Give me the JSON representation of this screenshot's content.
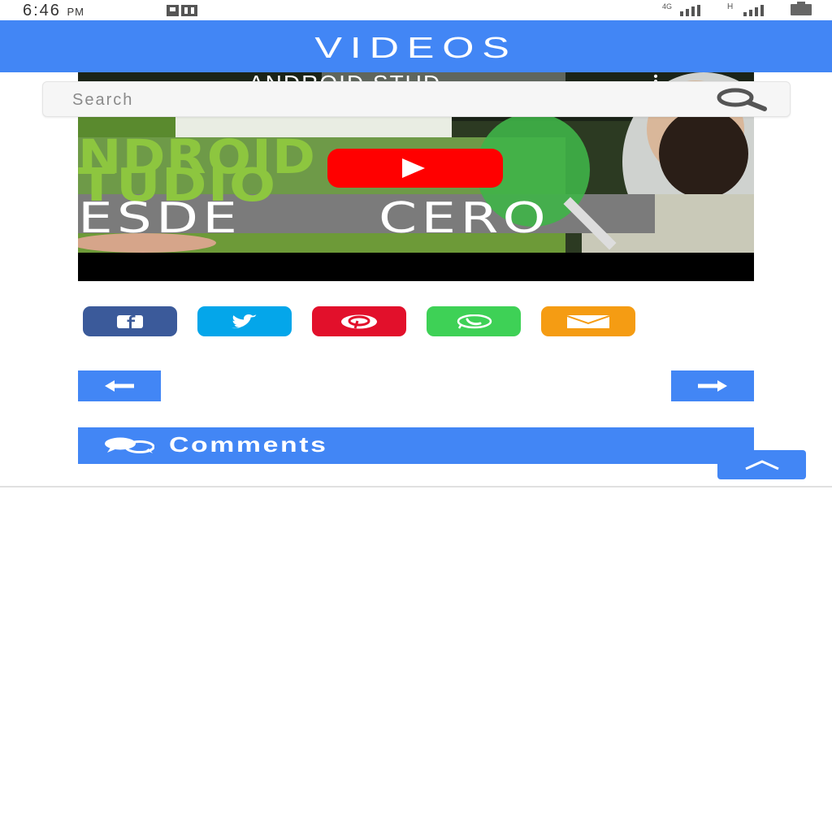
{
  "status_bar": {
    "time": "6:46",
    "ampm": "PM",
    "app_icon": "app-notification-icon",
    "signal_icons": [
      "signal-4g-icon",
      "signal-h-icon",
      "battery-icon"
    ]
  },
  "header": {
    "title": "VIDEOS"
  },
  "search": {
    "placeholder": "Search",
    "value": "",
    "icon": "search-icon"
  },
  "video": {
    "thumbnail_title_partial": "ANDROID STUD",
    "overlay_line1": "NDROID",
    "overlay_line2": "TUDIO",
    "overlay_line3": "ESDE",
    "overlay_line4": "CERO",
    "play_icon": "youtube-play-icon",
    "more_icon": "more-vertical-icon"
  },
  "share": [
    {
      "name": "facebook",
      "icon": "facebook-icon",
      "color": "#3b5a9a"
    },
    {
      "name": "twitter",
      "icon": "twitter-icon",
      "color": "#04a6ea"
    },
    {
      "name": "pinterest",
      "icon": "pinterest-icon",
      "color": "#e2102b"
    },
    {
      "name": "whatsapp",
      "icon": "whatsapp-icon",
      "color": "#3ed156"
    },
    {
      "name": "email",
      "icon": "email-icon",
      "color": "#f59c13"
    }
  ],
  "navigation": {
    "prev_icon": "arrow-left-icon",
    "next_icon": "arrow-right-icon"
  },
  "comments": {
    "label": "Comments",
    "icon": "comments-icon"
  },
  "scroll_top": {
    "icon": "chevron-up-icon"
  },
  "colors": {
    "primary": "#4286f5",
    "youtube_red": "#ff0000"
  }
}
